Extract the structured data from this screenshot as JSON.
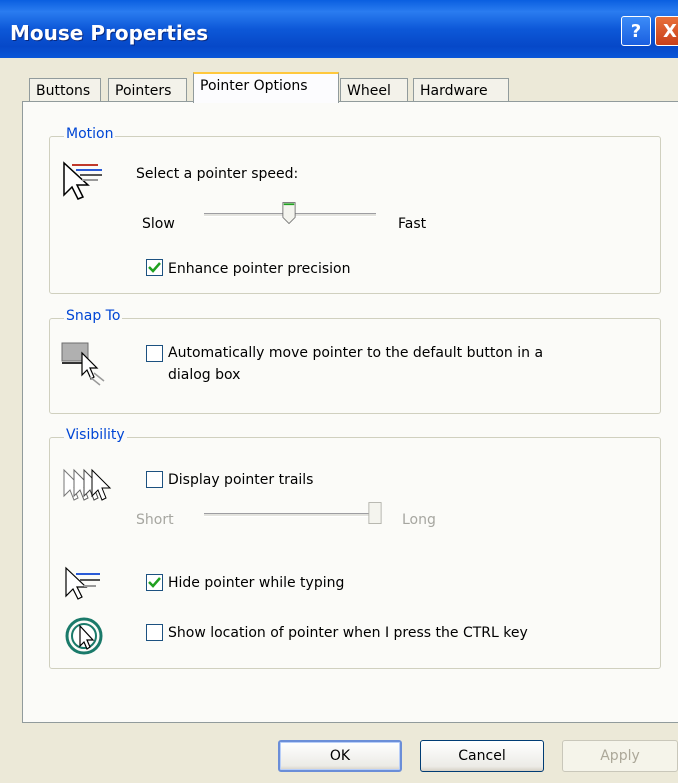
{
  "window": {
    "title": "Mouse Properties",
    "help_label": "?",
    "close_label": "X"
  },
  "tabs": [
    {
      "label": "Buttons"
    },
    {
      "label": "Pointers"
    },
    {
      "label": "Pointer Options",
      "active": true
    },
    {
      "label": "Wheel"
    },
    {
      "label": "Hardware"
    }
  ],
  "motion": {
    "title": "Motion",
    "prompt": "Select a pointer speed:",
    "slow_label": "Slow",
    "fast_label": "Fast",
    "speed_level": 0.5,
    "enhance_label": "Enhance pointer precision",
    "enhance_checked": true
  },
  "snap_to": {
    "title": "Snap To",
    "label_line1": "Automatically move pointer to the default button in a",
    "label_line2": "dialog box",
    "checked": false
  },
  "visibility": {
    "title": "Visibility",
    "trails_label": "Display pointer trails",
    "trails_checked": false,
    "short_label": "Short",
    "long_label": "Long",
    "trail_length": 1.0,
    "hide_label": "Hide pointer while typing",
    "hide_checked": true,
    "show_location_label": "Show location of pointer when I press the CTRL key",
    "show_location_checked": false
  },
  "buttons": {
    "ok": "OK",
    "cancel": "Cancel",
    "apply": "Apply"
  },
  "colors": {
    "accent": "#0046d5",
    "check": "#21a121",
    "titlebar": "#0a56d8"
  }
}
